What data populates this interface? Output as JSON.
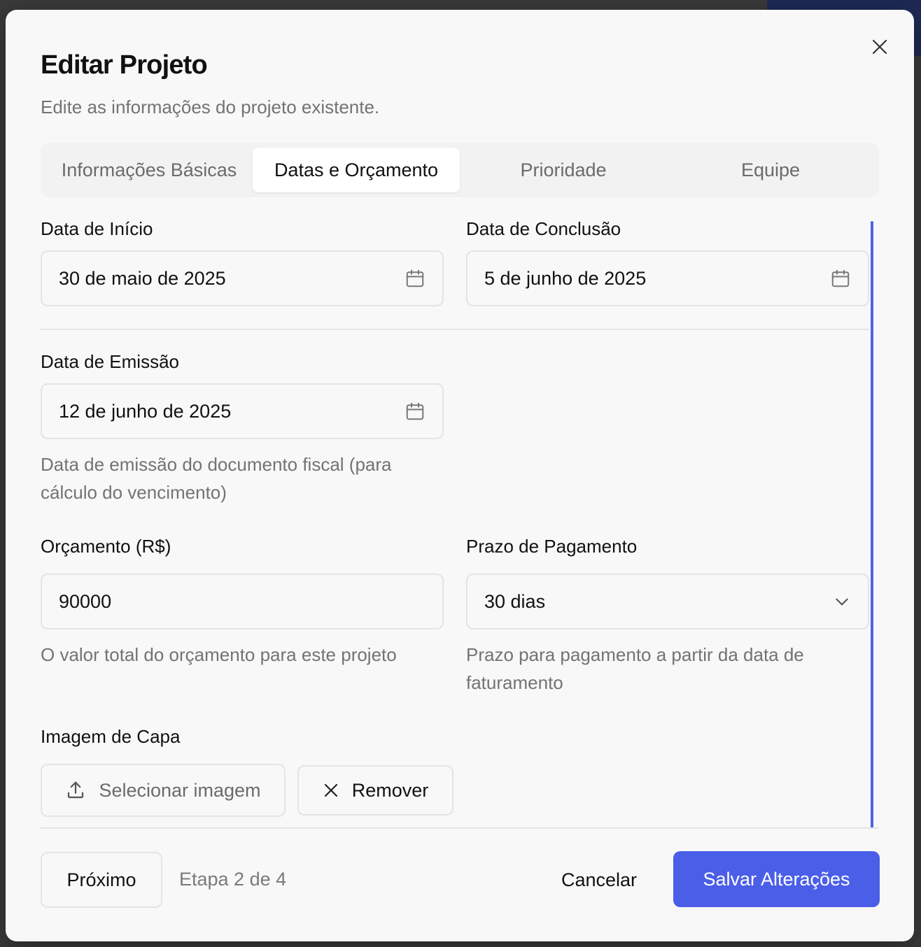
{
  "dialog": {
    "title": "Editar Projeto",
    "subtitle": "Edite as informações do projeto existente."
  },
  "tabs": [
    {
      "label": "Informações Básicas",
      "active": false
    },
    {
      "label": "Datas e Orçamento",
      "active": true
    },
    {
      "label": "Prioridade",
      "active": false
    },
    {
      "label": "Equipe",
      "active": false
    }
  ],
  "form": {
    "start_date": {
      "label": "Data de Início",
      "value": "30 de maio de 2025"
    },
    "end_date": {
      "label": "Data de Conclusão",
      "value": "5 de junho de 2025"
    },
    "issue_date": {
      "label": "Data de Emissão",
      "value": "12 de junho de 2025",
      "hint": "Data de emissão do documento fiscal (para cálculo do vencimento)"
    },
    "budget": {
      "label": "Orçamento (R$)",
      "value": "90000",
      "hint": "O valor total do orçamento para este projeto"
    },
    "payment_term": {
      "label": "Prazo de Pagamento",
      "value": "30 dias",
      "hint": "Prazo para pagamento a partir da data de faturamento"
    },
    "cover_image": {
      "label": "Imagem de Capa",
      "select_label": "Selecionar imagem",
      "remove_label": "Remover"
    }
  },
  "footer": {
    "next_label": "Próximo",
    "step_text": "Etapa 2 de 4",
    "cancel_label": "Cancelar",
    "save_label": "Salvar Alterações"
  },
  "colors": {
    "accent": "#4a5ee8",
    "scrollbar": "#4f63e0"
  },
  "icons": {
    "close": "close-icon",
    "calendar": "calendar-icon",
    "chevron": "chevron-down-icon",
    "upload": "upload-icon",
    "remove": "x-icon"
  }
}
